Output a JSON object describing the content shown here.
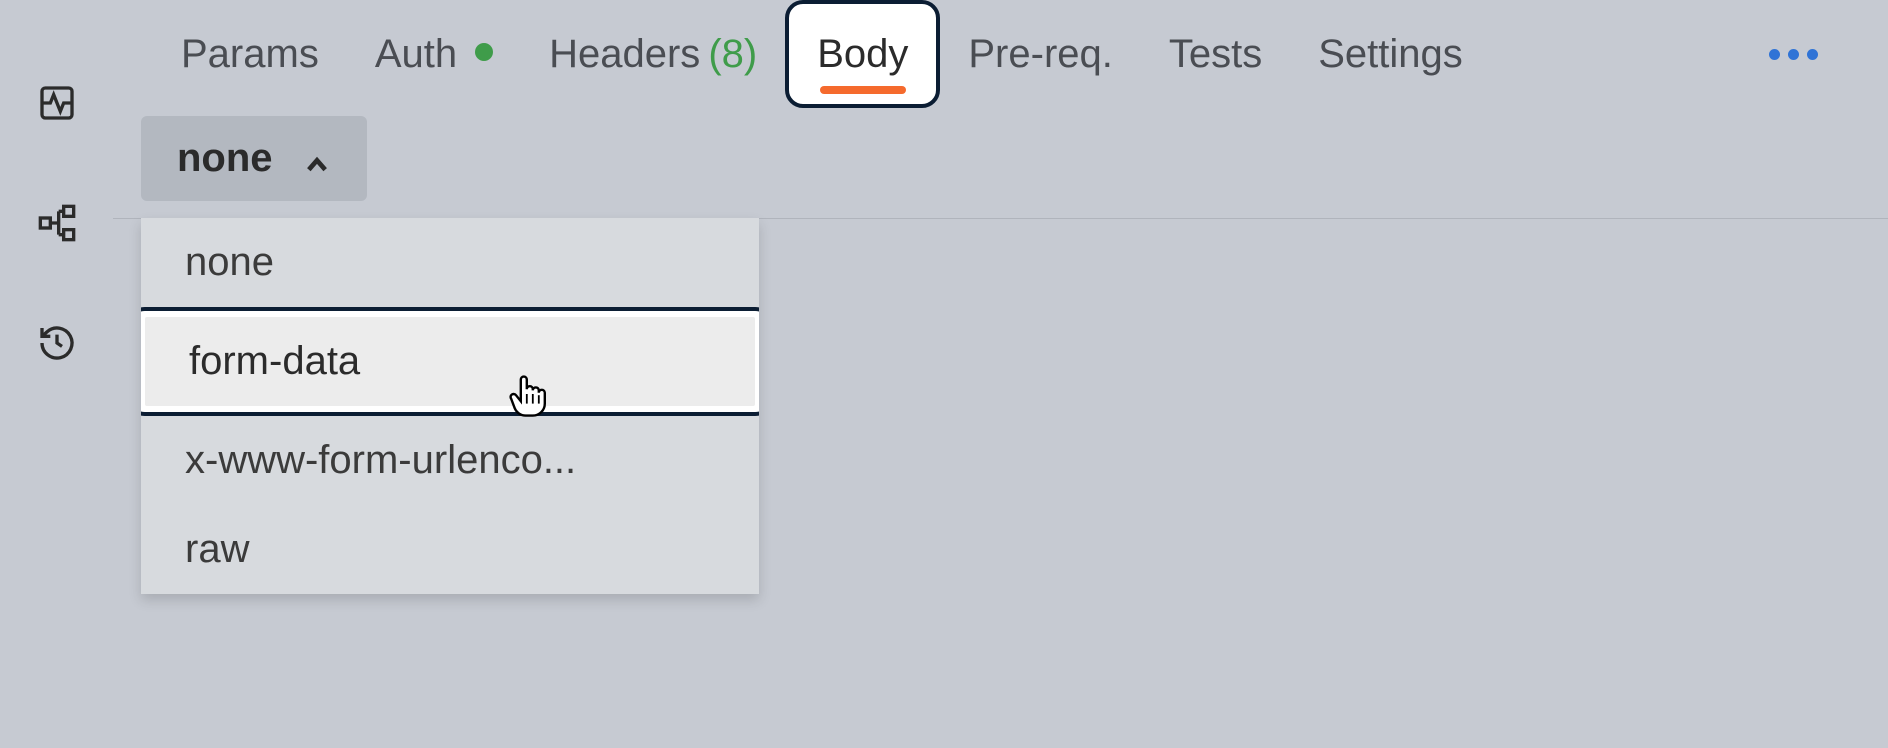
{
  "sidebar": {
    "icons": [
      "activity-icon",
      "flow-icon",
      "history-icon"
    ]
  },
  "tabs": {
    "items": [
      {
        "label": "Params",
        "active": false
      },
      {
        "label": "Auth",
        "active": false,
        "has_dot": true
      },
      {
        "label": "Headers",
        "count": "(8)",
        "active": false
      },
      {
        "label": "Body",
        "active": true
      },
      {
        "label": "Pre-req.",
        "active": false
      },
      {
        "label": "Tests",
        "active": false
      },
      {
        "label": "Settings",
        "active": false
      }
    ]
  },
  "body_type": {
    "selected": "none",
    "options": [
      {
        "label": "none"
      },
      {
        "label": "form-data",
        "highlighted": true
      },
      {
        "label": "x-www-form-urlenco..."
      },
      {
        "label": "raw"
      }
    ]
  },
  "colors": {
    "accent_orange": "#f56a2d",
    "accent_green": "#3f9c4a",
    "accent_blue": "#2f73d6",
    "highlight_border": "#0b1d33"
  }
}
